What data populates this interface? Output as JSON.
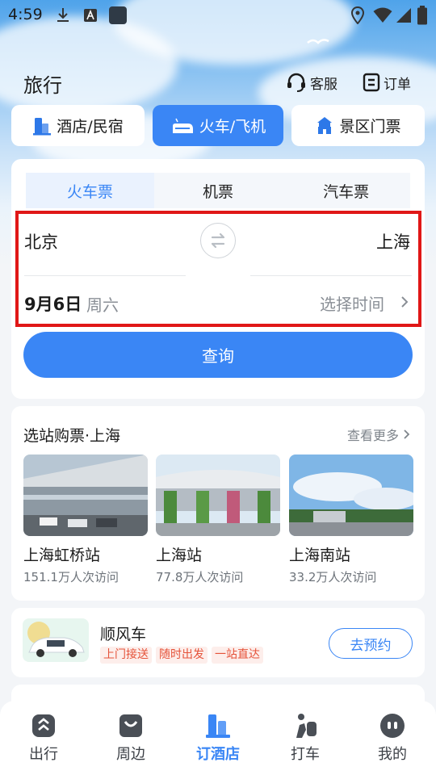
{
  "status_bar": {
    "time": "4:59"
  },
  "header": {
    "title": "旅行",
    "service_label": "客服",
    "orders_label": "订单"
  },
  "categories": [
    {
      "label": "酒店/民宿",
      "active": false
    },
    {
      "label": "火车/飞机",
      "active": true
    },
    {
      "label": "景区门票",
      "active": false
    }
  ],
  "ticket_tabs": [
    {
      "label": "火车票",
      "active": true
    },
    {
      "label": "机票",
      "active": false
    },
    {
      "label": "汽车票",
      "active": false
    }
  ],
  "search": {
    "from_city": "北京",
    "to_city": "上海",
    "date": "9月6日",
    "weekday": "周六",
    "time_placeholder": "选择时间",
    "button_label": "查询"
  },
  "stations": {
    "title": "选站购票·上海",
    "more_label": "查看更多",
    "items": [
      {
        "name": "上海虹桥站",
        "visits": "151.1万人次访问"
      },
      {
        "name": "上海站",
        "visits": "77.8万人次访问"
      },
      {
        "name": "上海南站",
        "visits": "33.2万人次访问"
      }
    ]
  },
  "carpool": {
    "title": "顺风车",
    "tags": [
      "上门接送",
      "随时出发",
      "一站直达"
    ],
    "button_label": "去预约"
  },
  "bottom_nav": [
    {
      "label": "出行",
      "icon": "travel-icon",
      "active": false
    },
    {
      "label": "周边",
      "icon": "nearby-icon",
      "active": false
    },
    {
      "label": "订酒店",
      "icon": "hotel-icon",
      "active": true
    },
    {
      "label": "打车",
      "icon": "taxi-icon",
      "active": false
    },
    {
      "label": "我的",
      "icon": "profile-icon",
      "active": false
    }
  ],
  "colors": {
    "accent": "#3a86f5",
    "highlight_border": "#e01717",
    "tag_text": "#e5533a"
  }
}
